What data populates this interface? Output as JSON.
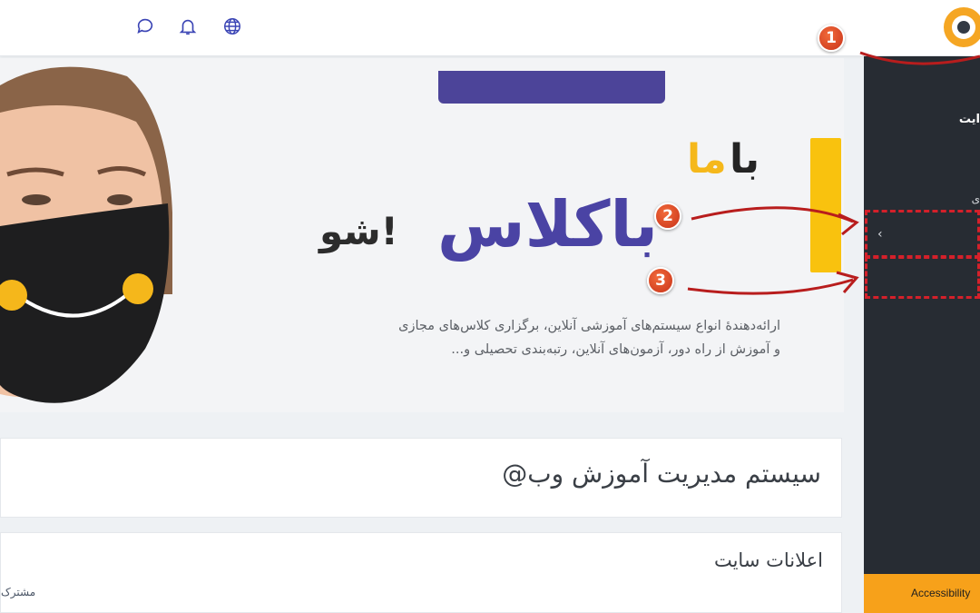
{
  "header": {
    "logo_icon": "site-logo-icon",
    "icons": [
      "message-icon",
      "bell-icon",
      "globe-icon"
    ],
    "accent": "#3b45b5"
  },
  "sidebar": {
    "title": "ایت",
    "subtitle": "ی",
    "chevron": "‹",
    "accessibility_label": "Accessibility",
    "background": "#272c33",
    "accessibility_color": "#f7a11a"
  },
  "hero": {
    "ba": "با",
    "ma": "ما",
    "baklass": "باکلاس",
    "sho": "شو!",
    "description_line1": "ارائه‌دهندهٔ انواع سیستم‌های آموزشی آنلاین، برگزاری کلاس‌های مجازی",
    "description_line2": "و آموزش از راه دور، آزمون‌های آنلاین، رتبه‌بندی تحصیلی و...",
    "purple": "#4c4499",
    "yellow": "#f9c20e"
  },
  "site_title": "سیستم مدیریت آموزش وب@",
  "announcements": {
    "title": "اعلانات سایت",
    "link": "مشترک"
  },
  "annotations": {
    "badges": [
      "1",
      "2",
      "3"
    ],
    "color": "#c8331a"
  }
}
